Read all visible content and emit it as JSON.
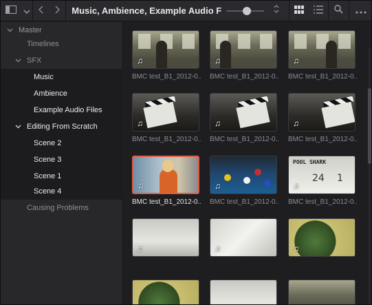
{
  "toolbar": {
    "title": "Music, Ambience, Example Audio Files...",
    "zoom_level": 0.55
  },
  "sidebar": {
    "items": [
      {
        "label": "Master",
        "expanded": true
      },
      {
        "label": "Timelines"
      },
      {
        "label": "SFX",
        "expanded": true
      },
      {
        "label": "Music",
        "selected": true
      },
      {
        "label": "Ambience",
        "selected": true
      },
      {
        "label": "Example Audio Files",
        "selected": true
      },
      {
        "label": "Editing From Scratch",
        "expanded": true,
        "selected": true
      },
      {
        "label": "Scene 2",
        "selected": true
      },
      {
        "label": "Scene 3",
        "selected": true
      },
      {
        "label": "Scene 1",
        "selected": true
      },
      {
        "label": "Scene 4",
        "selected": true
      },
      {
        "label": "Causing Problems"
      }
    ]
  },
  "clips": [
    {
      "caption": "BMC test_B1_2012-0...",
      "art": "room"
    },
    {
      "caption": "BMC test_B1_2012-0...",
      "art": "room"
    },
    {
      "caption": "BMC test_B1_2012-0...",
      "art": "room"
    },
    {
      "caption": "BMC test_B1_2012-0...",
      "art": "clap"
    },
    {
      "caption": "BMC test_B1_2012-0...",
      "art": "clap"
    },
    {
      "caption": "BMC test_B1_2012-0...",
      "art": "clap"
    },
    {
      "caption": "BMC test_B1_2012-0...",
      "art": "orange",
      "selected": true
    },
    {
      "caption": "BMC test_B1_2012-0...",
      "art": "pool"
    },
    {
      "caption": "BMC test_B1_2012-0...",
      "art": "clap2"
    },
    {
      "caption": "",
      "art": "blur"
    },
    {
      "caption": "",
      "art": "blur2"
    },
    {
      "caption": "",
      "art": "green"
    }
  ],
  "slate": {
    "line1": "POOL SHARK",
    "scene": "24",
    "take": "1"
  },
  "colors": {
    "selection": "#e25a45",
    "accent": "#c8c8cc"
  }
}
